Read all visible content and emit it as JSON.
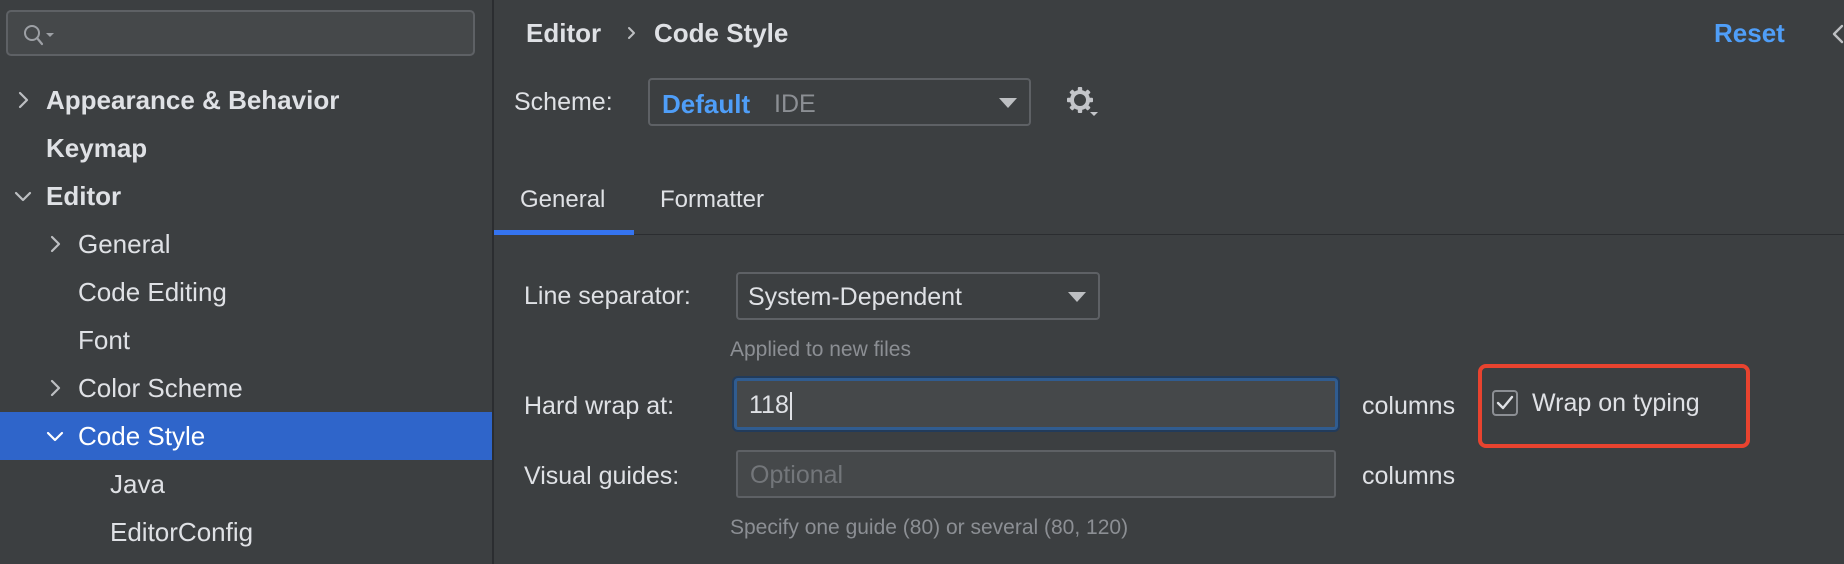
{
  "sidebar": {
    "search": {
      "value": "",
      "placeholder": ""
    },
    "items": [
      {
        "label": "Appearance & Behavior"
      },
      {
        "label": "Keymap"
      },
      {
        "label": "Editor"
      },
      {
        "label": "General"
      },
      {
        "label": "Code Editing"
      },
      {
        "label": "Font"
      },
      {
        "label": "Color Scheme"
      },
      {
        "label": "Code Style"
      },
      {
        "label": "Java"
      },
      {
        "label": "EditorConfig"
      }
    ]
  },
  "header": {
    "breadcrumb": [
      "Editor",
      "Code Style"
    ],
    "reset_label": "Reset"
  },
  "scheme": {
    "label": "Scheme:",
    "value": "Default",
    "qualifier": "IDE"
  },
  "tabs": [
    {
      "label": "General",
      "active": true
    },
    {
      "label": "Formatter",
      "active": false
    }
  ],
  "general": {
    "line_separator": {
      "label": "Line separator:",
      "value": "System-Dependent",
      "hint": "Applied to new files"
    },
    "hard_wrap": {
      "label": "Hard wrap at:",
      "value": "118",
      "unit": "columns"
    },
    "wrap_on_typing": {
      "label": "Wrap on typing",
      "checked": true
    },
    "visual_guides": {
      "label": "Visual guides:",
      "placeholder": "Optional",
      "unit": "columns",
      "hint": "Specify one guide (80) or several (80, 120)"
    }
  },
  "colors": {
    "accent": "#4f9ef8",
    "selection": "#2f65ca",
    "highlight_border": "#e8432f"
  }
}
